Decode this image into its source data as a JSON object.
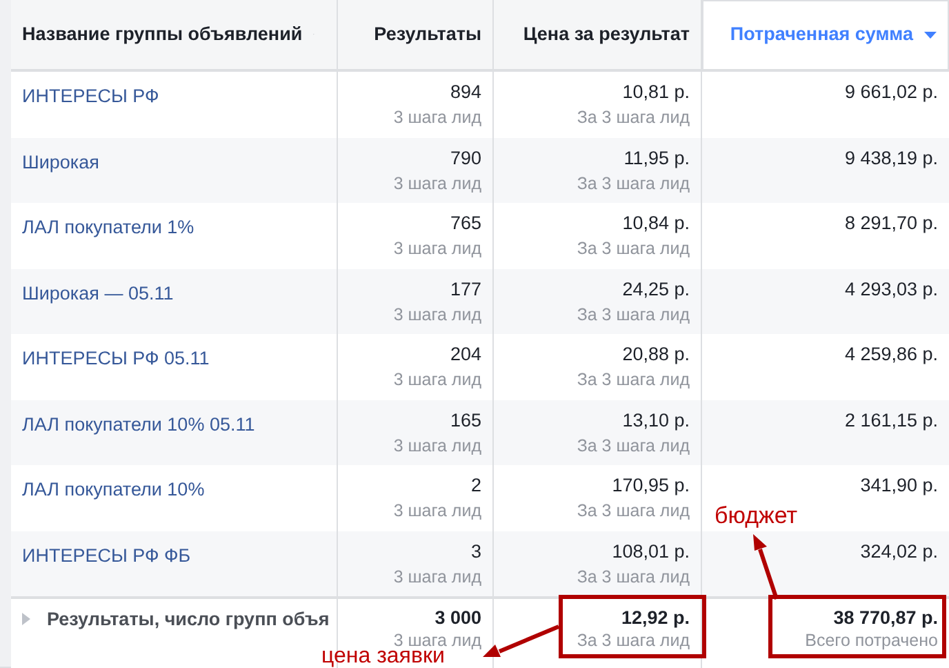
{
  "table": {
    "columns": [
      {
        "label": "Название группы объявлений",
        "sorted": false
      },
      {
        "label": "Результаты",
        "sorted": false
      },
      {
        "label": "Цена за результат",
        "sorted": false
      },
      {
        "label": "Потраченная сумма",
        "sorted": true
      }
    ],
    "rows": [
      {
        "name": "ИНТЕРЕСЫ РФ",
        "results": "894",
        "results_note": "3 шага лид",
        "cost": "10,81 р.",
        "cost_note": "За 3 шага лид",
        "spent": "9 661,02 р."
      },
      {
        "name": "Широкая",
        "results": "790",
        "results_note": "3 шага лид",
        "cost": "11,95 р.",
        "cost_note": "За 3 шага лид",
        "spent": "9 438,19 р."
      },
      {
        "name": "ЛАЛ покупатели 1%",
        "results": "765",
        "results_note": "3 шага лид",
        "cost": "10,84 р.",
        "cost_note": "За 3 шага лид",
        "spent": "8 291,70 р."
      },
      {
        "name": "Широкая — 05.11",
        "results": "177",
        "results_note": "3 шага лид",
        "cost": "24,25 р.",
        "cost_note": "За 3 шага лид",
        "spent": "4 293,03 р."
      },
      {
        "name": "ИНТЕРЕСЫ РФ 05.11",
        "results": "204",
        "results_note": "3 шага лид",
        "cost": "20,88 р.",
        "cost_note": "За 3 шага лид",
        "spent": "4 259,86 р."
      },
      {
        "name": "ЛАЛ покупатели 10% 05.11",
        "results": "165",
        "results_note": "3 шага лид",
        "cost": "13,10 р.",
        "cost_note": "За 3 шага лид",
        "spent": "2 161,15 р."
      },
      {
        "name": "ЛАЛ покупатели 10%",
        "results": "2",
        "results_note": "3 шага лид",
        "cost": "170,95 р.",
        "cost_note": "За 3 шага лид",
        "spent": "341,90 р."
      },
      {
        "name": "ИНТЕРЕСЫ РФ ФБ",
        "results": "3",
        "results_note": "3 шага лид",
        "cost": "108,01 р.",
        "cost_note": "За 3 шага лид",
        "spent": "324,02 р."
      }
    ],
    "summary": {
      "name": "Результаты, число групп объя",
      "results": "3 000",
      "results_note": "3 шага лид",
      "cost": "12,92 р.",
      "cost_note": "За 3 шага лид",
      "spent": "38 770,87 р.",
      "spent_note": "Всего потрачено"
    }
  },
  "annotations": [
    {
      "text": "бюджет"
    },
    {
      "text": "цена заявки"
    }
  ]
}
